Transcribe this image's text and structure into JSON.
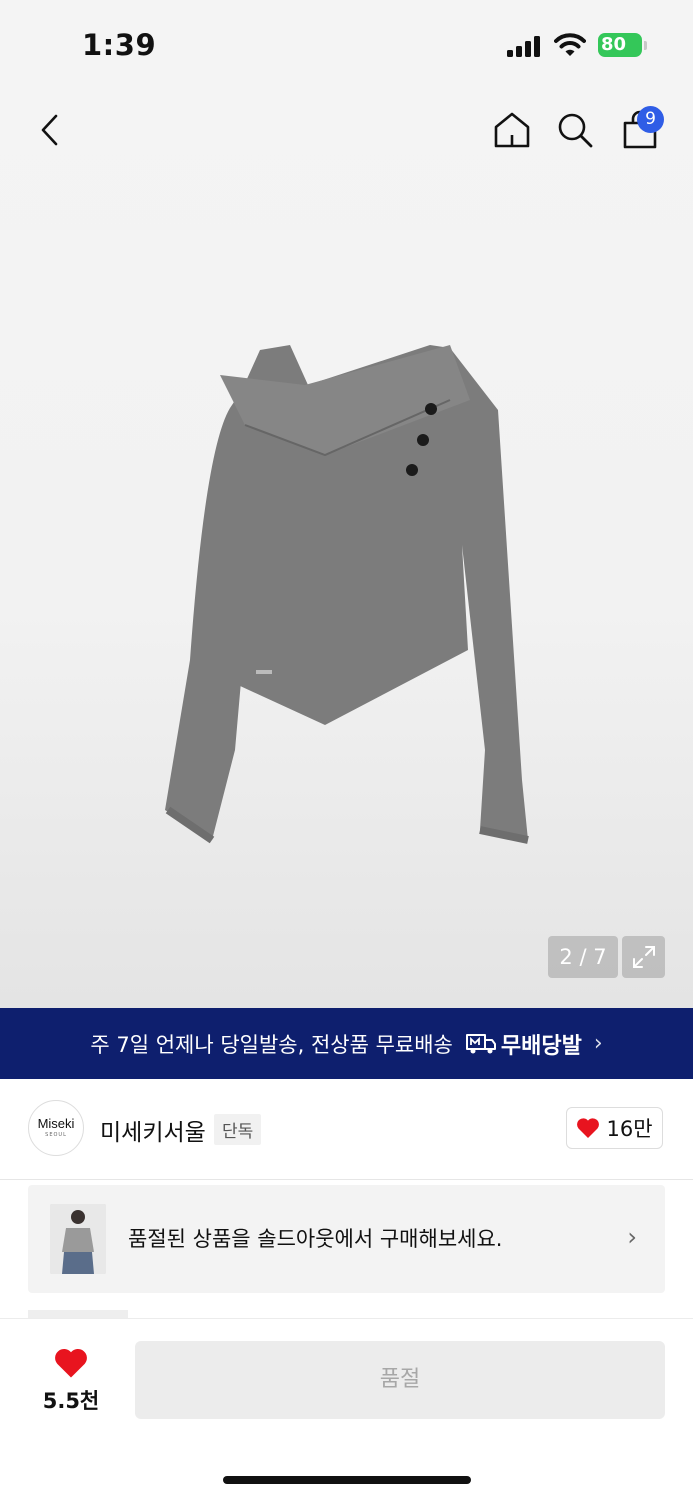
{
  "status_bar": {
    "time": "1:39",
    "battery": "80"
  },
  "nav": {
    "cart_count": "9"
  },
  "gallery": {
    "counter": "2 / 7"
  },
  "promo": {
    "text": "주 7일 언제나 당일발송, 전상품 무료배송",
    "brand": "무배당발"
  },
  "shop": {
    "logo_line1": "Miseki",
    "logo_line2": "SEOUL",
    "name": "미세키서울",
    "tag": "단독",
    "likes": "16만"
  },
  "soldout_card": {
    "text": "품절된 상품을 솔드아웃에서 구매해보세요."
  },
  "bottom": {
    "wish_count": "5.5천",
    "button_label": "품절"
  },
  "colors": {
    "promo_bg": "#0e1f6e",
    "badge": "#2f5de6",
    "heart": "#e8141f",
    "battery": "#34c759"
  },
  "icons": [
    "back-icon",
    "home-icon",
    "search-icon",
    "bag-icon",
    "expand-icon",
    "truck-icon",
    "chevron-right-icon",
    "heart-icon"
  ]
}
